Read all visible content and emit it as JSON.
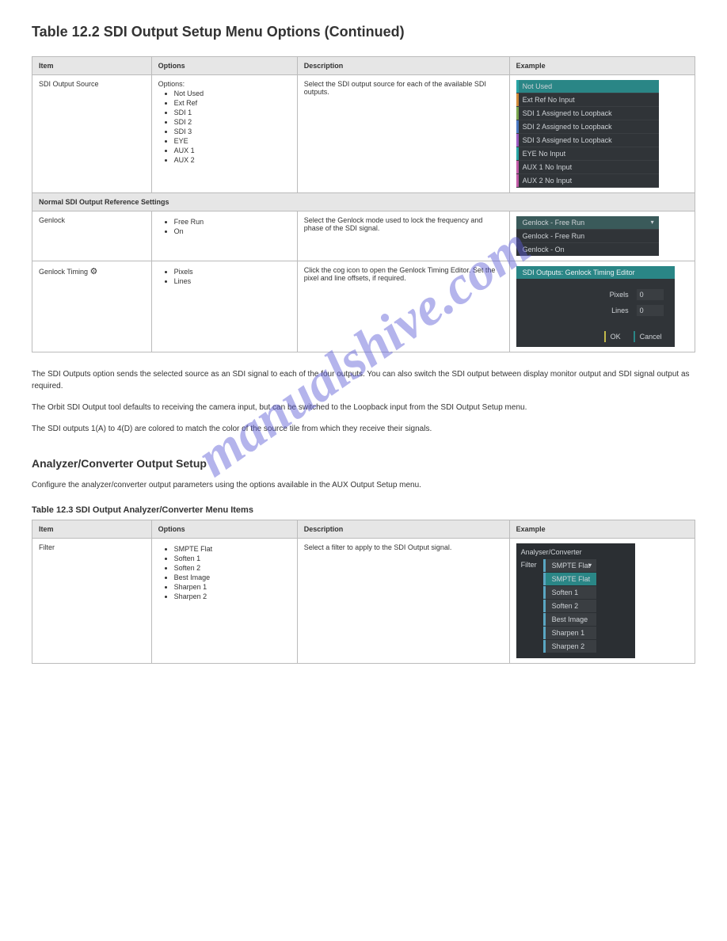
{
  "page_title": "Table 12.2 SDI Output Setup Menu Options (Continued)",
  "table1": {
    "headers": [
      "Item",
      "Options",
      "Description",
      "Example"
    ],
    "rows": [
      {
        "item": "SDI Output Source",
        "opts_label": "Options:",
        "opts": [
          "Not Used",
          "Ext Ref",
          "SDI 1",
          "SDI 2",
          "SDI 3",
          "EYE",
          "AUX 1",
          "AUX 2"
        ],
        "desc": "Select the SDI output source for each of the available SDI outputs.",
        "scr": {
          "type": "list",
          "rows": [
            {
              "label": "Not Used",
              "cls": "c-teal selected"
            },
            {
              "label": "Ext Ref No Input",
              "cls": "c-orange"
            },
            {
              "label": "SDI 1 Assigned to Loopback",
              "cls": "c-green"
            },
            {
              "label": "SDI 2 Assigned to Loopback",
              "cls": "c-blue"
            },
            {
              "label": "SDI 3 Assigned to Loopback",
              "cls": "c-purple"
            },
            {
              "label": "EYE No Input",
              "cls": "c-teal"
            },
            {
              "label": "AUX 1 No Input",
              "cls": "c-mag"
            },
            {
              "label": "AUX 2 No Input",
              "cls": "c-mag"
            }
          ]
        }
      },
      {
        "subhead": "Normal SDI Output Reference Settings"
      },
      {
        "item": "Genlock",
        "opts": [
          "Free Run",
          "On"
        ],
        "desc": "Select the Genlock mode used to lock the frequency and phase of the SDI signal.",
        "scr": {
          "type": "drop",
          "hdr": "Genlock - Free Run",
          "opts": [
            "Genlock - Free Run",
            "Genlock - On"
          ]
        }
      },
      {
        "item": "Genlock Timing",
        "gear": true,
        "opts": [
          "Pixels",
          "Lines"
        ],
        "desc": "Click the cog icon to open the Genlock Timing Editor. Set the pixel and line offsets, if required.",
        "scr": {
          "type": "panel",
          "title": "SDI Outputs: Genlock Timing Editor",
          "fields": [
            {
              "label": "Pixels",
              "value": "0"
            },
            {
              "label": "Lines",
              "value": "0"
            }
          ],
          "ok": "OK",
          "cancel": "Cancel"
        }
      }
    ]
  },
  "body_paragraphs": [
    "The SDI Outputs option sends the selected source as an SDI signal to each of the four outputs. You can also switch the SDI output between display monitor output and SDI signal output as required.",
    "The Orbit SDI Output tool defaults to receiving the camera input, but can be switched to the Loopback input from the SDI Output Setup menu.",
    "The SDI outputs 1(A) to 4(D) are colored to match the color of the source tile from which they receive their signals."
  ],
  "analyzer_head": "Analyzer/Converter Output Setup",
  "analyzer_para": "Configure the analyzer/converter output parameters using the options available in the AUX Output Setup menu.",
  "table2_caption": "Table 12.3 SDI Output Analyzer/Converter Menu Items",
  "table2": {
    "headers": [
      "Item",
      "Options",
      "Description",
      "Example"
    ],
    "rows": [
      {
        "item": "Filter",
        "opts": [
          "SMPTE Flat",
          "Soften 1",
          "Soften 2",
          "Best Image",
          "Sharpen 1",
          "Sharpen 2"
        ],
        "desc": "Select a filter to apply to the SDI Output signal.",
        "scr": {
          "type": "filter",
          "title": "Analyser/Converter",
          "label": "Filter",
          "opts": [
            "SMPTE Flat",
            "SMPTE Flat",
            "Soften 1",
            "Soften 2",
            "Best Image",
            "Sharpen 1",
            "Sharpen 2"
          ]
        }
      }
    ]
  },
  "watermark": "manualshive.com"
}
